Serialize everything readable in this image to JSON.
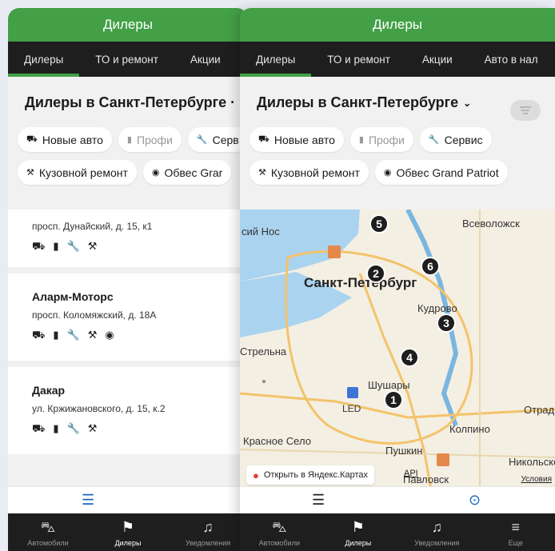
{
  "header": {
    "title": "Дилеры"
  },
  "tabs": [
    "Дилеры",
    "ТО и ремонт",
    "Акции",
    "Авто в нал"
  ],
  "tabs_left": [
    "Дилеры",
    "ТО и ремонт",
    "Акции"
  ],
  "city": {
    "title": "Дилеры в Санкт-Петербурге",
    "title_left": "Дилеры в Санкт-Петербурге ·"
  },
  "chips_row1": [
    {
      "icon": "car-icon",
      "glyph": "⛟",
      "label": "Новые авто",
      "muted": false
    },
    {
      "icon": "pro-icon",
      "glyph": "▮",
      "label": "Профи",
      "muted": true
    },
    {
      "icon": "wrench-icon",
      "glyph": "🔧",
      "label": "Сервис",
      "muted": false
    }
  ],
  "chips_row1_left_last": "Серв",
  "chips_row2": [
    {
      "icon": "paint-gun-icon",
      "glyph": "⚒",
      "label": "Кузовной ремонт"
    },
    {
      "icon": "tire-icon",
      "glyph": "◉",
      "label": "Обвес Grand Patriot"
    }
  ],
  "chips_row2_left_last": "Обвес Grar",
  "dealers": [
    {
      "name": "",
      "address": "просп. Дунайский, д. 15, к1",
      "icons": [
        "⛟",
        "▮",
        "🔧",
        "⚒"
      ]
    },
    {
      "name": "Аларм-Моторс",
      "address": "просп. Коломяжский, д. 18А",
      "icons": [
        "⛟",
        "▮",
        "🔧",
        "⚒",
        "◉"
      ]
    },
    {
      "name": "Дакар",
      "address": "ул. Кржижановского, д. 15, к.2",
      "icons": [
        "⛟",
        "▮",
        "🔧",
        "⚒"
      ]
    }
  ],
  "map": {
    "labels": {
      "spb": "Санкт-Петербург",
      "vsevolozhsk": "Всеволожск",
      "kudrovo": "Кудрово",
      "strelna": "Стрельна",
      "shushary": "Шушары",
      "krasnoe_selo": "Красное Село",
      "kolpino": "Колпино",
      "pushkin": "Пушкин",
      "nikolskoe": "Никольское",
      "otradnoe": "Отрад",
      "pavlovsk": "Павловск",
      "led": "LED",
      "nos": "сий Нос"
    },
    "pins": [
      "5",
      "2",
      "6",
      "3",
      "4",
      "1"
    ],
    "open_yandex": "Открыть в Яндекс.Картах",
    "api": "API",
    "terms": "Условия"
  },
  "nav": [
    {
      "label": "Автомобили",
      "icon": "car-outline-icon",
      "glyph": "⛍"
    },
    {
      "label": "Дилеры",
      "icon": "flag-icon",
      "glyph": "⚑"
    },
    {
      "label": "Уведомления",
      "icon": "bell-icon",
      "glyph": "🔔"
    },
    {
      "label": "Еще",
      "icon": "menu-icon",
      "glyph": "≡"
    }
  ],
  "colors": {
    "green": "#43a047",
    "dark": "#1e1e1e",
    "accent_blue": "#1565c0"
  }
}
